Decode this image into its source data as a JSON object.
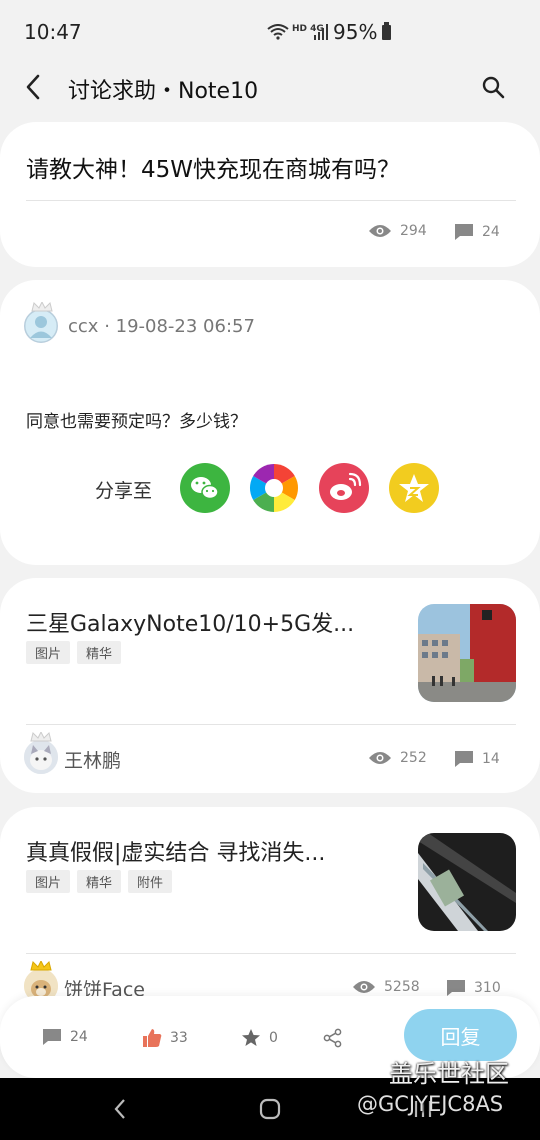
{
  "status_bar": {
    "time": "10:47",
    "network": "HD 4G",
    "battery": "95%"
  },
  "header": {
    "title": "讨论求助・Note10"
  },
  "question_card": {
    "title": "请教大神！45W快充现在商城有吗？",
    "views": "294",
    "comments": "24"
  },
  "post": {
    "author": "ccx",
    "date": "· 19-08-23 06:57",
    "body": "同意也需要预定吗？多少钱？",
    "share_label": "分享至"
  },
  "related": [
    {
      "title": "三星GalaxyNote10/10+5G发...",
      "tags": [
        "图片",
        "精华"
      ],
      "author": "王林鹏",
      "views": "252",
      "comments": "14"
    },
    {
      "title": "真真假假|虚实结合 寻找消失...",
      "tags": [
        "图片",
        "精华",
        "附件"
      ],
      "author": "饼饼Face",
      "views": "5258",
      "comments": "310"
    }
  ],
  "bottom_bar": {
    "comments": "24",
    "likes": "33",
    "favorites": "0",
    "reply_label": "回复"
  },
  "watermark": {
    "line1": "盖乐世社区",
    "line2": "@GCJYEJC8AS"
  },
  "colors": {
    "reply": "#8fd3ef",
    "wechat": "#3db540",
    "weibo": "#e6435a",
    "qzone": "#f2cc1f",
    "like": "#e8735a"
  }
}
